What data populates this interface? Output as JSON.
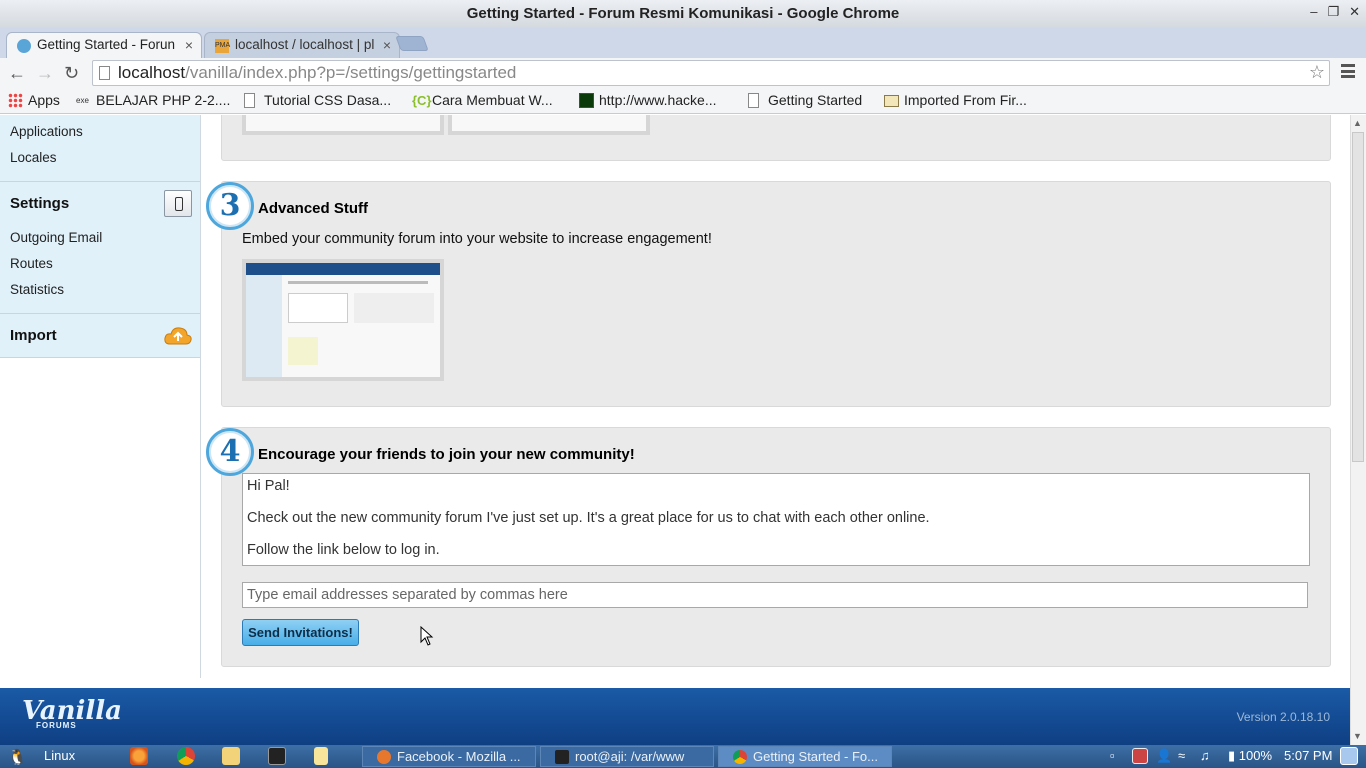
{
  "window": {
    "title": "Getting Started - Forum Resmi Komunikasi - Google Chrome",
    "controls": [
      "minimize",
      "maximize",
      "close"
    ]
  },
  "tabs": [
    {
      "label": "Getting Started - Forun",
      "icon": "vanilla-favicon-icon",
      "active": true
    },
    {
      "label": "localhost / localhost | pl",
      "icon": "phpmyadmin-icon",
      "active": false
    }
  ],
  "toolbar": {
    "url_host": "localhost",
    "url_path": "/vanilla/index.php?p=/settings/gettingstarted"
  },
  "bookmarks": [
    {
      "label": "Apps",
      "icon": "apps-grid-icon"
    },
    {
      "label": "BELAJAR PHP 2-2....",
      "icon": "exe-icon"
    },
    {
      "label": "Tutorial CSS Dasa...",
      "icon": "page-icon"
    },
    {
      "label": "Cara Membuat W...",
      "icon": "green-c-icon"
    },
    {
      "label": "http://www.hacke...",
      "icon": "matrix-icon"
    },
    {
      "label": "Getting Started",
      "icon": "page-icon"
    },
    {
      "label": "Imported From Fir...",
      "icon": "folder-icon"
    }
  ],
  "sidebar": {
    "top_items": [
      "Applications",
      "Locales"
    ],
    "settings": {
      "heading": "Settings",
      "items": [
        "Outgoing Email",
        "Routes",
        "Statistics"
      ]
    },
    "import": {
      "heading": "Import"
    }
  },
  "steps": {
    "step3": {
      "number": "3",
      "heading": "Advanced Stuff",
      "description": "Embed your community forum into your website to increase engagement!"
    },
    "step4": {
      "number": "4",
      "heading": "Encourage your friends to join your new community!",
      "message_lines": [
        "Hi Pal!",
        "Check out the new community forum I've just set up. It's a great place for us to chat with each other online.",
        "Follow the link below to log in."
      ],
      "email_placeholder": "Type email addresses separated by commas here",
      "send_label": "Send Invitations!"
    }
  },
  "footer": {
    "logo_text": "Vanilla",
    "logo_sub": "FORUMS",
    "version": "Version 2.0.18.10"
  },
  "taskbar": {
    "start_label": "Linux",
    "windows": [
      {
        "label": "Facebook - Mozilla ...",
        "icon": "firefox-icon",
        "active": false
      },
      {
        "label": "root@aji: /var/www",
        "icon": "terminal-icon",
        "active": false
      },
      {
        "label": "Getting Started - Fo...",
        "icon": "chrome-icon",
        "active": true
      }
    ],
    "battery": "100%",
    "clock": "5:07 PM"
  },
  "colors": {
    "accent": "#4ea7dc",
    "footer": "#1a5aa6",
    "sidebar_bg": "#e0f1fa",
    "taskbar": "#3d6fa6"
  }
}
